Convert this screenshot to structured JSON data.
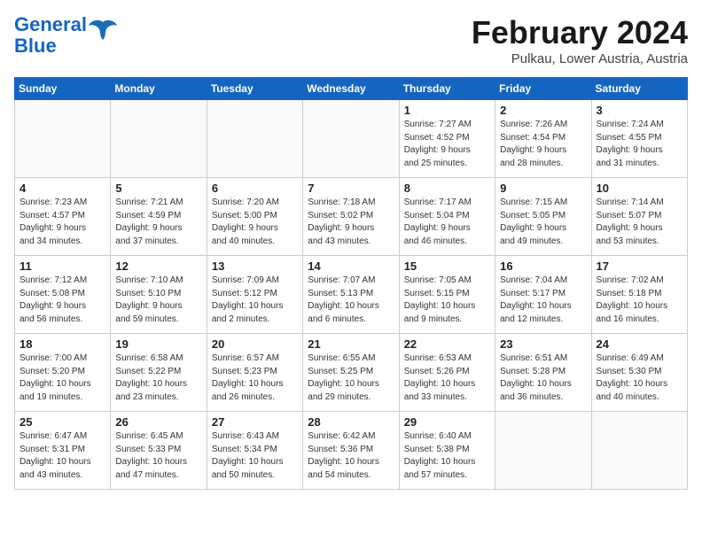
{
  "header": {
    "logo_line1": "General",
    "logo_line2": "Blue",
    "month": "February 2024",
    "location": "Pulkau, Lower Austria, Austria"
  },
  "weekdays": [
    "Sunday",
    "Monday",
    "Tuesday",
    "Wednesday",
    "Thursday",
    "Friday",
    "Saturday"
  ],
  "weeks": [
    [
      {
        "day": "",
        "info": ""
      },
      {
        "day": "",
        "info": ""
      },
      {
        "day": "",
        "info": ""
      },
      {
        "day": "",
        "info": ""
      },
      {
        "day": "1",
        "info": "Sunrise: 7:27 AM\nSunset: 4:52 PM\nDaylight: 9 hours\nand 25 minutes."
      },
      {
        "day": "2",
        "info": "Sunrise: 7:26 AM\nSunset: 4:54 PM\nDaylight: 9 hours\nand 28 minutes."
      },
      {
        "day": "3",
        "info": "Sunrise: 7:24 AM\nSunset: 4:55 PM\nDaylight: 9 hours\nand 31 minutes."
      }
    ],
    [
      {
        "day": "4",
        "info": "Sunrise: 7:23 AM\nSunset: 4:57 PM\nDaylight: 9 hours\nand 34 minutes."
      },
      {
        "day": "5",
        "info": "Sunrise: 7:21 AM\nSunset: 4:59 PM\nDaylight: 9 hours\nand 37 minutes."
      },
      {
        "day": "6",
        "info": "Sunrise: 7:20 AM\nSunset: 5:00 PM\nDaylight: 9 hours\nand 40 minutes."
      },
      {
        "day": "7",
        "info": "Sunrise: 7:18 AM\nSunset: 5:02 PM\nDaylight: 9 hours\nand 43 minutes."
      },
      {
        "day": "8",
        "info": "Sunrise: 7:17 AM\nSunset: 5:04 PM\nDaylight: 9 hours\nand 46 minutes."
      },
      {
        "day": "9",
        "info": "Sunrise: 7:15 AM\nSunset: 5:05 PM\nDaylight: 9 hours\nand 49 minutes."
      },
      {
        "day": "10",
        "info": "Sunrise: 7:14 AM\nSunset: 5:07 PM\nDaylight: 9 hours\nand 53 minutes."
      }
    ],
    [
      {
        "day": "11",
        "info": "Sunrise: 7:12 AM\nSunset: 5:08 PM\nDaylight: 9 hours\nand 56 minutes."
      },
      {
        "day": "12",
        "info": "Sunrise: 7:10 AM\nSunset: 5:10 PM\nDaylight: 9 hours\nand 59 minutes."
      },
      {
        "day": "13",
        "info": "Sunrise: 7:09 AM\nSunset: 5:12 PM\nDaylight: 10 hours\nand 2 minutes."
      },
      {
        "day": "14",
        "info": "Sunrise: 7:07 AM\nSunset: 5:13 PM\nDaylight: 10 hours\nand 6 minutes."
      },
      {
        "day": "15",
        "info": "Sunrise: 7:05 AM\nSunset: 5:15 PM\nDaylight: 10 hours\nand 9 minutes."
      },
      {
        "day": "16",
        "info": "Sunrise: 7:04 AM\nSunset: 5:17 PM\nDaylight: 10 hours\nand 12 minutes."
      },
      {
        "day": "17",
        "info": "Sunrise: 7:02 AM\nSunset: 5:18 PM\nDaylight: 10 hours\nand 16 minutes."
      }
    ],
    [
      {
        "day": "18",
        "info": "Sunrise: 7:00 AM\nSunset: 5:20 PM\nDaylight: 10 hours\nand 19 minutes."
      },
      {
        "day": "19",
        "info": "Sunrise: 6:58 AM\nSunset: 5:22 PM\nDaylight: 10 hours\nand 23 minutes."
      },
      {
        "day": "20",
        "info": "Sunrise: 6:57 AM\nSunset: 5:23 PM\nDaylight: 10 hours\nand 26 minutes."
      },
      {
        "day": "21",
        "info": "Sunrise: 6:55 AM\nSunset: 5:25 PM\nDaylight: 10 hours\nand 29 minutes."
      },
      {
        "day": "22",
        "info": "Sunrise: 6:53 AM\nSunset: 5:26 PM\nDaylight: 10 hours\nand 33 minutes."
      },
      {
        "day": "23",
        "info": "Sunrise: 6:51 AM\nSunset: 5:28 PM\nDaylight: 10 hours\nand 36 minutes."
      },
      {
        "day": "24",
        "info": "Sunrise: 6:49 AM\nSunset: 5:30 PM\nDaylight: 10 hours\nand 40 minutes."
      }
    ],
    [
      {
        "day": "25",
        "info": "Sunrise: 6:47 AM\nSunset: 5:31 PM\nDaylight: 10 hours\nand 43 minutes."
      },
      {
        "day": "26",
        "info": "Sunrise: 6:45 AM\nSunset: 5:33 PM\nDaylight: 10 hours\nand 47 minutes."
      },
      {
        "day": "27",
        "info": "Sunrise: 6:43 AM\nSunset: 5:34 PM\nDaylight: 10 hours\nand 50 minutes."
      },
      {
        "day": "28",
        "info": "Sunrise: 6:42 AM\nSunset: 5:36 PM\nDaylight: 10 hours\nand 54 minutes."
      },
      {
        "day": "29",
        "info": "Sunrise: 6:40 AM\nSunset: 5:38 PM\nDaylight: 10 hours\nand 57 minutes."
      },
      {
        "day": "",
        "info": ""
      },
      {
        "day": "",
        "info": ""
      }
    ]
  ]
}
